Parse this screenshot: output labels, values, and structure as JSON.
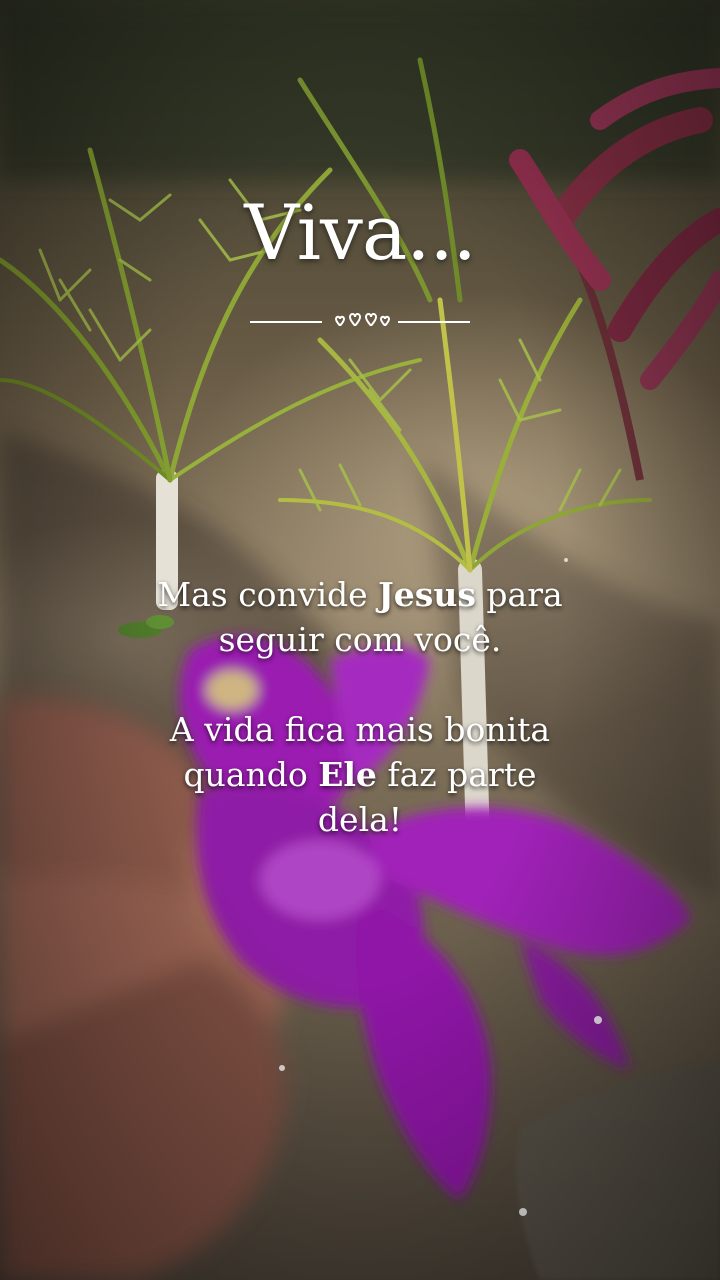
{
  "title": "Viva...",
  "message": {
    "line1_pre": "Mas convide ",
    "line1_bold": "Jesus",
    "line1_post": " para",
    "line2": "seguir com você.",
    "line3": "A vida fica mais bonita",
    "line4_pre": "quando ",
    "line4_bold": "Ele",
    "line4_post": " faz parte",
    "line5": "dela!"
  },
  "colors": {
    "text": "#ffffff",
    "flower": "#a21fb8",
    "palm": "#9bb43a",
    "ground": "#8a7a62"
  },
  "icons": [
    "heart-icon",
    "heart-icon",
    "heart-icon",
    "heart-icon"
  ]
}
